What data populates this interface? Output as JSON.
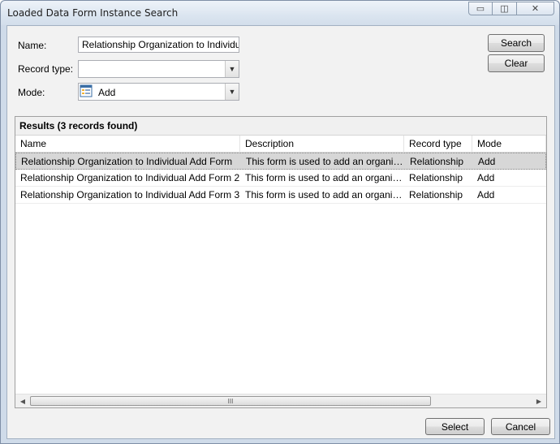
{
  "window": {
    "title": "Loaded Data Form Instance Search",
    "min_glyph": "▭",
    "max_glyph": "◫",
    "close_glyph": "✕"
  },
  "form": {
    "name_label": "Name:",
    "name_value": "Relationship Organization to Individual A",
    "record_type_label": "Record type:",
    "record_type_value": "",
    "mode_label": "Mode:",
    "mode_value": "Add",
    "mode_icon": "form-icon",
    "dropdown_glyph": "▼"
  },
  "buttons": {
    "search": "Search",
    "clear": "Clear",
    "select": "Select",
    "cancel": "Cancel"
  },
  "results": {
    "title": "Results (3 records found)",
    "columns": [
      "Name",
      "Description",
      "Record type",
      "Mode"
    ],
    "rows": [
      [
        "Relationship Organization to Individual Add Form",
        "This form is used to add an organizati...",
        "Relationship",
        "Add"
      ],
      [
        "Relationship Organization to Individual Add Form 2",
        "This form is used to add an organizati...",
        "Relationship",
        "Add"
      ],
      [
        "Relationship Organization to Individual Add Form 3",
        "This form is used to add an organizati...",
        "Relationship",
        "Add"
      ]
    ],
    "selected_row": 0,
    "scroll_left_glyph": "◀",
    "scroll_right_glyph": "▶",
    "scroll_grip": "III"
  }
}
